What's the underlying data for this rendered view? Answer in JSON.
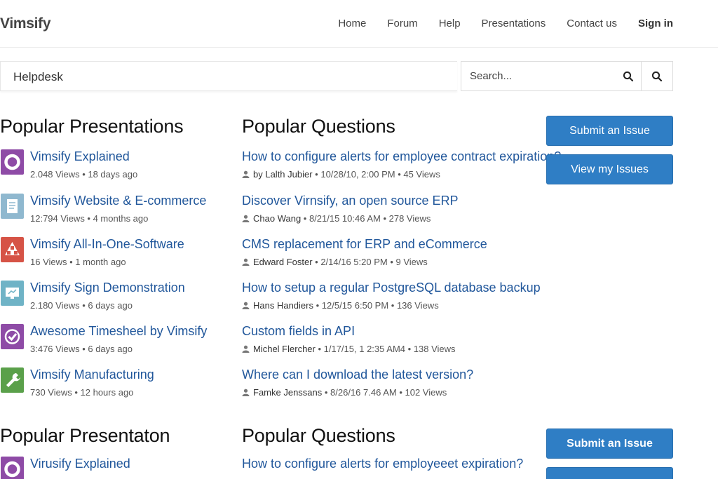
{
  "header": {
    "brand": "Vimsify",
    "nav": [
      "Home",
      "Forum",
      "Help",
      "Presentations",
      "Contact us"
    ],
    "signin": "Sign in"
  },
  "helpdesk": {
    "label": "Helpdesk"
  },
  "search": {
    "placeholder": "Search..."
  },
  "section1": {
    "presentations_title": "Popular Presentations",
    "questions_title": "Popular Questions",
    "submit_label": "Submit an Issue",
    "view_label": "View my Issues",
    "presentations": [
      {
        "title": "Vimsify Explained",
        "meta": "2.048 Views • 18 days ago",
        "icon": "circle-icon",
        "color": "#8e4ba6"
      },
      {
        "title": "Vimsify Website & E-commerce",
        "meta": "12:794 Views • 4 months ago",
        "icon": "document-icon",
        "color": "#8fb8cf"
      },
      {
        "title": "Vimsify All-In-One-Software",
        "meta": "16 Views • 1 month ago",
        "icon": "triangle-icon",
        "color": "#d65346"
      },
      {
        "title": "Vimsify Sign Demonstration",
        "meta": "2.180 Views • 6 days ago",
        "icon": "monitor-icon",
        "color": "#6fb3c6"
      },
      {
        "title": "Awesome Timesheel by Vimsify",
        "meta": "3:476 Views • 6 days ago",
        "icon": "check-icon",
        "color": "#8e4ba6"
      },
      {
        "title": "Vimsify Manufacturing",
        "meta": "730 Views • 12 hours ago",
        "icon": "wrench-icon",
        "color": "#5aa04a"
      }
    ],
    "questions": [
      {
        "title": "How to configure alerts for employee contract expiration?",
        "author": "by Lalth Jubier",
        "meta": " • 10/28/10, 2:00 PM • 45 Views"
      },
      {
        "title": "Discover Virnsify, an open source ERP",
        "author": "Chao Wang",
        "meta": " • 8/21/15 10:46 AM • 278 Views"
      },
      {
        "title": "CMS replacement for ERP and eCommerce",
        "author": "Edward Foster",
        "meta": " • 2/14/16 5:20 PM • 9 Views"
      },
      {
        "title": "How to setup a regular PostgreSQL database backup",
        "author": "Hans Handiers",
        "meta": " • 12/5/15 6:50 PM • 136 Views"
      },
      {
        "title": "Custom fields in API",
        "author": "Michel Flercher",
        "meta": " • 1/17/15, 1 2:35 AM4 • 138 Views"
      },
      {
        "title": "Where can I download the latest version?",
        "author": "Famke Jenssans",
        "meta": " • 8/26/16 7.46 AM • 102 Views"
      }
    ]
  },
  "section2": {
    "presentations_title": "Popular Presentaton",
    "questions_title": "Popular Questions",
    "submit_label": "Submit an Issue",
    "first_presentation": "Virusify Explained",
    "first_question": "How to configure alerts for employeeet expiration?"
  }
}
